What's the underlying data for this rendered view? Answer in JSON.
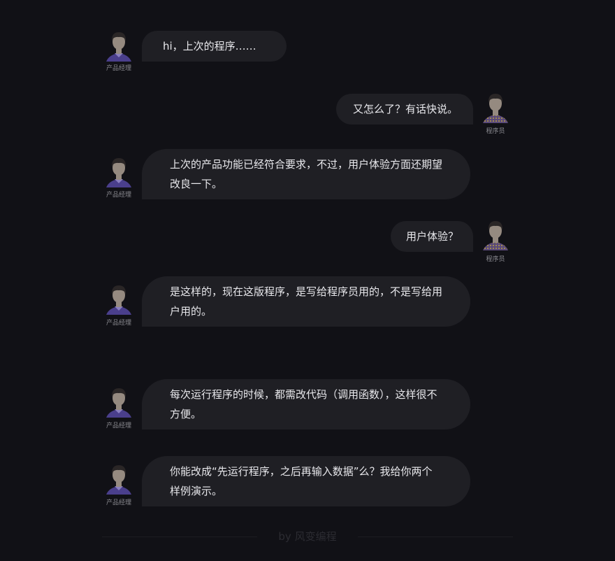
{
  "roles": {
    "pm": "产品经理",
    "dev": "程序员"
  },
  "messages": [
    {
      "from": "pm",
      "text": "hi，上次的程序……"
    },
    {
      "from": "dev",
      "text": "又怎么了？有话快说。"
    },
    {
      "from": "pm",
      "text": "上次的产品功能已经符合要求，不过，用户体验方面还期望改良一下。"
    },
    {
      "from": "dev",
      "text": "用户体验？"
    },
    {
      "from": "pm",
      "text": "是这样的，现在这版程序，是写给程序员用的，不是写给用户用的。"
    },
    {
      "from": "pm",
      "text": "每次运行程序的时候，都需改代码（调用函数），这样很不方便。"
    },
    {
      "from": "pm",
      "text": "你能改成“先运行程序，之后再输入数据”么？我给你两个样例演示。"
    }
  ],
  "footer": "by 风变编程",
  "colors": {
    "background": "#111116",
    "bubble": "#1f1f24",
    "pm_shirt": "#4a3f8c",
    "dev_shirt": "#6a4f8a"
  }
}
